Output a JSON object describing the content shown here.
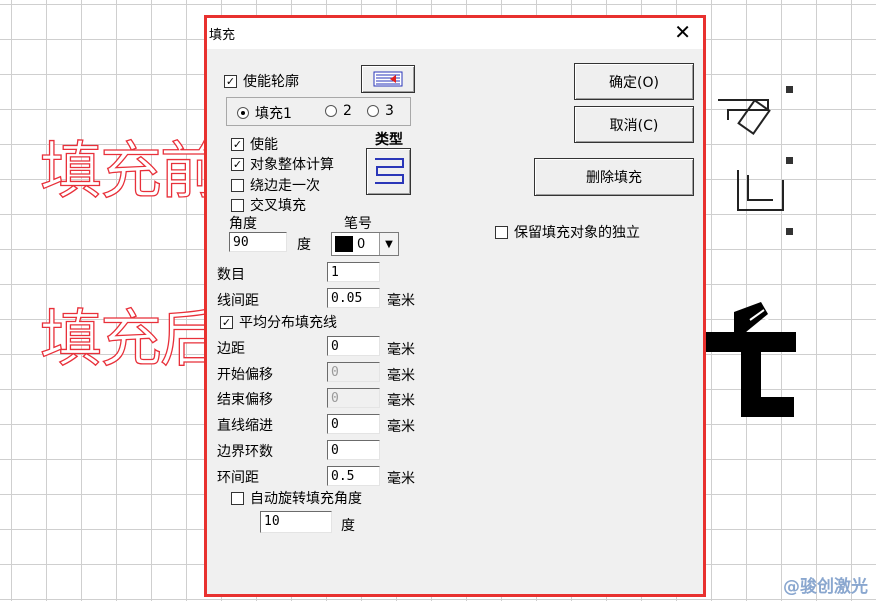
{
  "canvas": {
    "before_text": "填充前",
    "after_text": "填充后",
    "watermark": "@骏创激光",
    "colors": {
      "outline": "#e8303a",
      "grid": "#cfcfcf",
      "dialog_border": "#e8312f"
    }
  },
  "dialog": {
    "title": "填充",
    "close_glyph": "✕",
    "enable_outline": {
      "label": "使能轮廓",
      "checked": true
    },
    "fill_radios": [
      {
        "label": "填充1",
        "selected": true
      },
      {
        "label": "2",
        "selected": false
      },
      {
        "label": "3",
        "selected": false
      }
    ],
    "enable": {
      "label": "使能",
      "checked": true
    },
    "whole_object_calc": {
      "label": "对象整体计算",
      "checked": true
    },
    "edge_once": {
      "label": "绕边走一次",
      "checked": false
    },
    "cross_fill": {
      "label": "交叉填充",
      "checked": false
    },
    "type_label": "类型",
    "angle_label": "角度",
    "angle_value": "90",
    "angle_unit": "度",
    "pen_label": "笔号",
    "pen_value": "0",
    "fields": [
      {
        "label": "数目",
        "value": "1",
        "unit": "",
        "disabled": false
      },
      {
        "label": "线间距",
        "value": "0.05",
        "unit": "毫米",
        "disabled": false
      }
    ],
    "even_distribute": {
      "label": "平均分布填充线",
      "checked": true
    },
    "fields2": [
      {
        "label": "边距",
        "value": "0",
        "unit": "毫米",
        "disabled": false
      },
      {
        "label": "开始偏移",
        "value": "0",
        "unit": "毫米",
        "disabled": true
      },
      {
        "label": "结束偏移",
        "value": "0",
        "unit": "毫米",
        "disabled": true
      },
      {
        "label": "直线缩进",
        "value": "0",
        "unit": "毫米",
        "disabled": false
      },
      {
        "label": "边界环数",
        "value": "0",
        "unit": "",
        "disabled": false
      },
      {
        "label": "环间距",
        "value": "0.5",
        "unit": "毫米",
        "disabled": false
      }
    ],
    "auto_rotate": {
      "label": "自动旋转填充角度",
      "checked": false
    },
    "rotate_value": "10",
    "rotate_unit": "度",
    "ok_label": "确定(O)",
    "cancel_label": "取消(C)",
    "delete_fill_label": "删除填充",
    "keep_independent": {
      "label": "保留填充对象的独立",
      "checked": false
    }
  }
}
